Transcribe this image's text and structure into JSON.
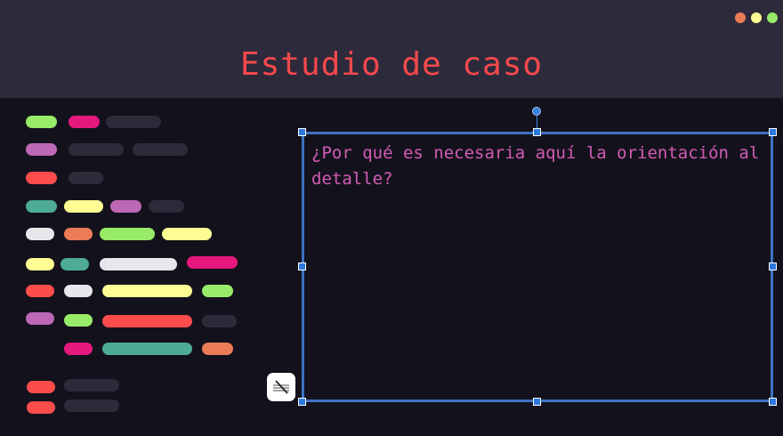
{
  "header": {
    "title": "Estudio de caso"
  },
  "window_controls": {
    "colors": [
      "#ec7b58",
      "#fefd93",
      "#97eb68"
    ]
  },
  "textbox": {
    "text": "¿Por qué es necesaria aquí la orientación al detalle?"
  },
  "toolbar": {
    "icon": "no-wrap-icon"
  }
}
